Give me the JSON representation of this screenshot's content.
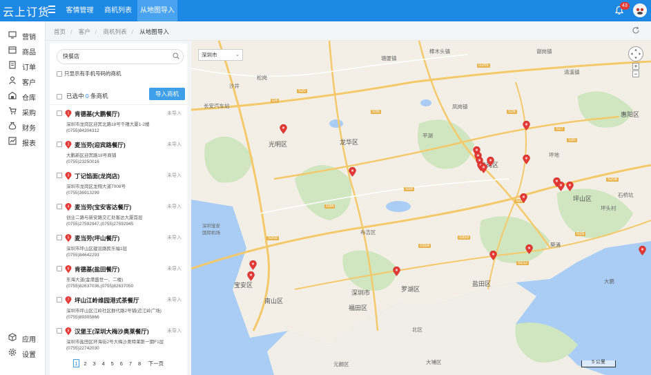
{
  "app": {
    "logo": "云上订货"
  },
  "topnav": {
    "tabs": [
      {
        "label": "客情管理",
        "active": false
      },
      {
        "label": "商机列表",
        "active": false
      },
      {
        "label": "从地图导入",
        "active": true
      }
    ],
    "notification_count": "43"
  },
  "sidebar": {
    "items": [
      {
        "label": "营销",
        "icon": "monitor-icon"
      },
      {
        "label": "商品",
        "icon": "box-icon"
      },
      {
        "label": "订单",
        "icon": "order-icon"
      },
      {
        "label": "客户",
        "icon": "user-icon"
      },
      {
        "label": "仓库",
        "icon": "warehouse-icon"
      },
      {
        "label": "采购",
        "icon": "cart-icon"
      },
      {
        "label": "财务",
        "icon": "money-bag-icon"
      },
      {
        "label": "报表",
        "icon": "chart-icon"
      }
    ],
    "bottom_items": [
      {
        "label": "应用",
        "icon": "cube-icon"
      },
      {
        "label": "设置",
        "icon": "gear-icon"
      }
    ]
  },
  "breadcrumb": [
    "首页",
    "客户",
    "商机列表",
    "从地图导入"
  ],
  "panel": {
    "search_value": "快餐店",
    "only_phone_label": "只显示有手机号码的商机",
    "selected_prefix": "已选中",
    "selected_count": "0",
    "selected_suffix": "条商机",
    "import_button": "导入商机",
    "stores": [
      {
        "index": "1",
        "name": "肯德基(大鹏餐厅)",
        "status": "未导入",
        "address": "深圳市龙岗区迎宾北路18号千禧大厦1-2楼",
        "phone": "(0755)84304312"
      },
      {
        "index": "2",
        "name": "麦当劳(迎宾路餐厅)",
        "status": "未导入",
        "address": "大鹏新区迎宾路18号商铺",
        "phone": "(0755)23250016"
      },
      {
        "index": "3",
        "name": "丁记馅面(龙岗店)",
        "status": "未导入",
        "address": "深圳市龙岗区龙翔大道7008号",
        "phone": "(0755)36913299"
      },
      {
        "index": "4",
        "name": "麦当劳(宝安客达餐厅)",
        "status": "未导入",
        "address": "创业二路与新安路交汇处客达大厦首层",
        "phone": "(0755)27592947,(0755)27592945"
      },
      {
        "index": "5",
        "name": "麦当劳(坪山餐厅)",
        "status": "未导入",
        "address": "深圳市坪山区建设路民乐福1层",
        "phone": "(0755)84642293"
      },
      {
        "index": "6",
        "name": "肯德基(盐田餐厅)",
        "status": "未导入",
        "address": "东海大道(金港盛世一、二楼)",
        "phone": "(0755)82637036,(0755)82637050"
      },
      {
        "index": "7",
        "name": "坪山江岭维园港式茶餐厅",
        "status": "未导入",
        "address": "深圳市坪山区江岭社区群代路2号铺(近江岭广场)",
        "phone": "(0755)89305866"
      },
      {
        "index": "8",
        "name": "汉堡王(深圳大梅沙奥莱餐厅)",
        "status": "未导入",
        "address": "深圳市盐田区环海街2号大梅沙奥特莱斯一期F1层",
        "phone": "(0755)22742030"
      }
    ],
    "pager": {
      "pages": [
        "1",
        "2",
        "3",
        "4",
        "5",
        "6",
        "7",
        "8"
      ],
      "current": "1",
      "next": "下一页"
    }
  },
  "map": {
    "city_select": "深圳市",
    "scale_label": "5 公里",
    "labels": [
      {
        "text": "光明区",
        "big": true
      },
      {
        "text": "龙华区",
        "big": true
      },
      {
        "text": "龙岗区",
        "big": true
      },
      {
        "text": "坪山区",
        "big": true
      },
      {
        "text": "宝安区",
        "big": true
      },
      {
        "text": "南山区",
        "big": true
      },
      {
        "text": "福田区",
        "big": true
      },
      {
        "text": "深圳市",
        "big": true
      },
      {
        "text": "罗湖区",
        "big": true
      },
      {
        "text": "盐田区",
        "big": true
      },
      {
        "text": "布吉区",
        "big": false
      },
      {
        "text": "惠阳区",
        "big": true
      },
      {
        "text": "元朗区",
        "big": false
      },
      {
        "text": "北区",
        "big": false
      },
      {
        "text": "大埔区",
        "big": false
      },
      {
        "text": "长安汽车站",
        "big": false
      },
      {
        "text": "深圳宝安国际机场",
        "big": false
      },
      {
        "text": "清溪镇",
        "big": false
      },
      {
        "text": "凤岗镇",
        "big": false
      },
      {
        "text": "樟木头镇",
        "big": false
      },
      {
        "text": "谢岗镇",
        "big": false
      },
      {
        "text": "塘厦镇",
        "big": false
      },
      {
        "text": "沙井",
        "big": false
      },
      {
        "text": "松岗",
        "big": false
      },
      {
        "text": "平湖",
        "big": false
      },
      {
        "text": "坪地",
        "big": false
      },
      {
        "text": "石桥坑",
        "big": false
      },
      {
        "text": "坪头村",
        "big": false
      },
      {
        "text": "葵涌",
        "big": false
      },
      {
        "text": "大鹏",
        "big": false
      }
    ],
    "roads": [
      "G4",
      "S20",
      "S36",
      "S39",
      "G205",
      "S30",
      "S26",
      "S27",
      "S28",
      "G94",
      "S353",
      "S358",
      "G15",
      "S208",
      "S359",
      "S212"
    ]
  }
}
